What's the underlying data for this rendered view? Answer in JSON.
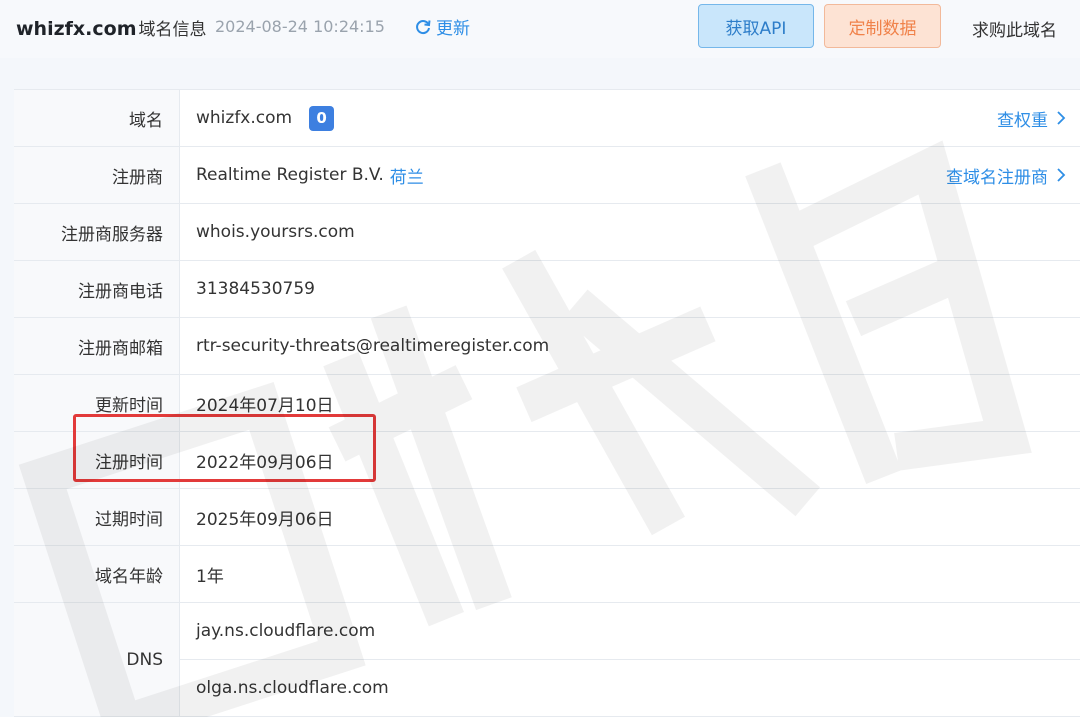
{
  "header": {
    "domain": "whizfx.com",
    "domain_suffix": "域名信息",
    "timestamp": "2024-08-24 10:24:15",
    "refresh_label": "更新",
    "api_button": "获取API",
    "custom_button": "定制数据",
    "buy_link": "求购此域名"
  },
  "rows": [
    {
      "label": "域名",
      "value": "whizfx.com",
      "badge": "0",
      "link": "查权重"
    },
    {
      "label": "注册商",
      "value": "Realtime Register B.V.",
      "country": "荷兰",
      "link": "查域名注册商"
    },
    {
      "label": "注册商服务器",
      "value": "whois.yoursrs.com"
    },
    {
      "label": "注册商电话",
      "value": "31384530759"
    },
    {
      "label": "注册商邮箱",
      "value": "rtr-security-threats@realtimeregister.com"
    },
    {
      "label": "更新时间",
      "value": "2024年07月10日"
    },
    {
      "label": "注册时间",
      "value": "2022年09月06日"
    },
    {
      "label": "过期时间",
      "value": "2025年09月06日"
    },
    {
      "label": "域名年龄",
      "value": "1年"
    }
  ],
  "dns": {
    "label": "DNS",
    "servers": [
      "jay.ns.cloudflare.com",
      "olga.ns.cloudflare.com"
    ]
  },
  "colors": {
    "accent": "#2e8ee6",
    "highlight": "#e23a3a"
  }
}
